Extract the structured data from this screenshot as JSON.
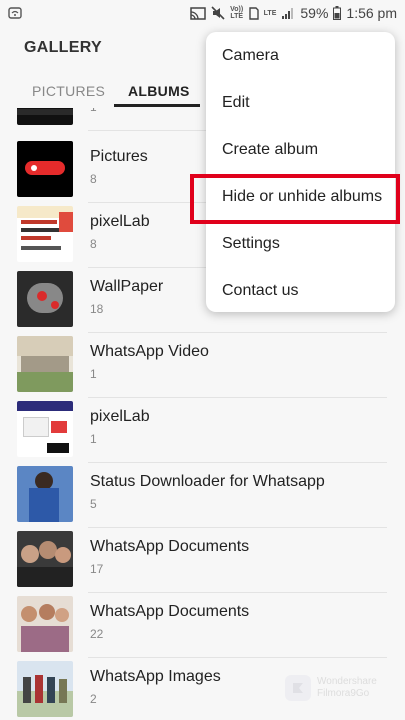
{
  "status_bar": {
    "time": "1:56 pm",
    "battery": "59%",
    "network": "LTE",
    "volte": "Vo)) LTE",
    "icons": [
      "wifi-icon",
      "cast-icon",
      "mute-icon",
      "volte-icon",
      "sim-icon",
      "signal-icon",
      "battery-icon"
    ]
  },
  "app": {
    "title": "GALLERY"
  },
  "tabs": [
    {
      "label": "PICTURES",
      "active": false
    },
    {
      "label": "ALBUMS",
      "active": true
    }
  ],
  "albums": [
    {
      "name": "",
      "count": "1"
    },
    {
      "name": "Pictures",
      "count": "8"
    },
    {
      "name": "pixelLab",
      "count": "8"
    },
    {
      "name": "WallPaper",
      "count": "18"
    },
    {
      "name": "WhatsApp Video",
      "count": "1"
    },
    {
      "name": "pixelLab",
      "count": "1"
    },
    {
      "name": "Status Downloader for Whatsapp",
      "count": "5"
    },
    {
      "name": "WhatsApp Documents",
      "count": "17"
    },
    {
      "name": "WhatsApp Documents",
      "count": "22"
    },
    {
      "name": "WhatsApp Images",
      "count": "2"
    }
  ],
  "menu": {
    "items": [
      "Camera",
      "Edit",
      "Create album",
      "Hide or unhide albums",
      "Settings",
      "Contact us"
    ],
    "highlighted": "Hide or unhide albums",
    "highlight_color": "#e0001b"
  },
  "watermark": {
    "line1": "Wondershare",
    "line2": "Filmora9Go"
  }
}
